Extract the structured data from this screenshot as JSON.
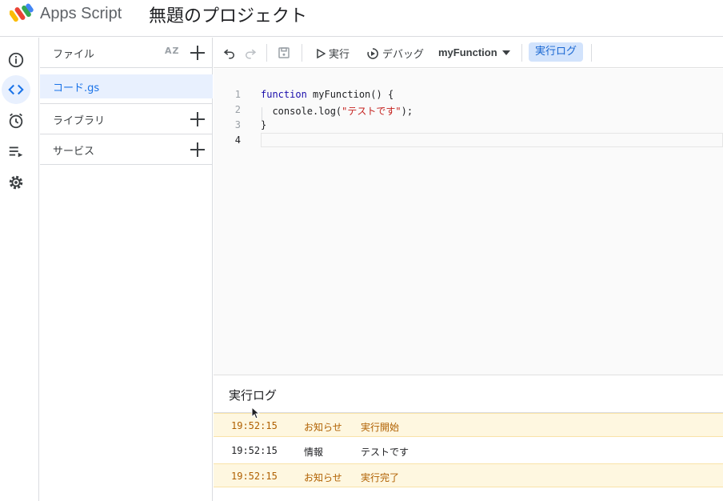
{
  "header": {
    "app_name": "Apps Script",
    "project_title": "無題のプロジェクト",
    "logo_icon": "apps-script-logo-icon"
  },
  "rail": {
    "items": [
      {
        "name": "overview",
        "icon": "info-icon"
      },
      {
        "name": "editor",
        "icon": "code-icon",
        "active": true
      },
      {
        "name": "triggers",
        "icon": "clock-icon"
      },
      {
        "name": "executions",
        "icon": "executions-icon"
      },
      {
        "name": "settings",
        "icon": "gear-icon"
      }
    ]
  },
  "files": {
    "header_label": "ファイル",
    "sort_label": "AZ",
    "items": [
      {
        "label": "コード.gs",
        "selected": true
      }
    ],
    "sections": [
      {
        "label": "ライブラリ"
      },
      {
        "label": "サービス"
      }
    ]
  },
  "toolbar": {
    "run_label": "実行",
    "debug_label": "デバッグ",
    "function_select": "myFunction",
    "log_label": "実行ログ"
  },
  "editor": {
    "line_numbers": [
      "1",
      "2",
      "3",
      "4"
    ],
    "lines": [
      {
        "kw": "function",
        "rest": " myFunction() {"
      },
      {
        "pre": "  console.log(",
        "str": "\"テストです\"",
        "post": ");"
      },
      {
        "pre": "}"
      },
      {
        "pre": ""
      }
    ]
  },
  "log": {
    "title": "実行ログ",
    "entries": [
      {
        "time": "19:52:15",
        "level": "お知らせ",
        "message": "実行開始",
        "type": "notice"
      },
      {
        "time": "19:52:15",
        "level": "情報",
        "message": "テストです",
        "type": "info"
      },
      {
        "time": "19:52:15",
        "level": "お知らせ",
        "message": "実行完了",
        "type": "notice"
      }
    ]
  },
  "colors": {
    "accent": "#1a73e8",
    "active_bg": "#e8f0fe",
    "notice_bg": "#fef7e0",
    "notice_text": "#b06000"
  }
}
